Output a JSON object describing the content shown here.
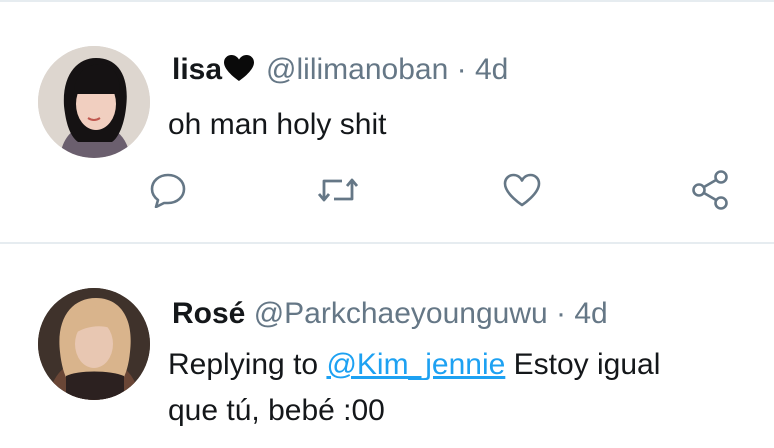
{
  "tweets": [
    {
      "name": "lisa",
      "name_suffix_icon": "black-heart-icon",
      "handle": "@lilimanoban",
      "separator": "·",
      "time": "4d",
      "text": "oh man holy shit",
      "actions": [
        "reply-icon",
        "retweet-icon",
        "like-icon",
        "share-icon"
      ]
    },
    {
      "name": "Rosé",
      "handle": "@Parkchaeyounguwu",
      "separator": "·",
      "time": "4d",
      "replying_prefix": "Replying to",
      "replying_to": "@Kim_jennie",
      "text_line1": "Estoy igual",
      "text_line2": "que tú, bebé :00"
    }
  ],
  "colors": {
    "icon_gray": "#657786",
    "link_blue": "#1da1f2",
    "divider": "#e6ecf0"
  }
}
